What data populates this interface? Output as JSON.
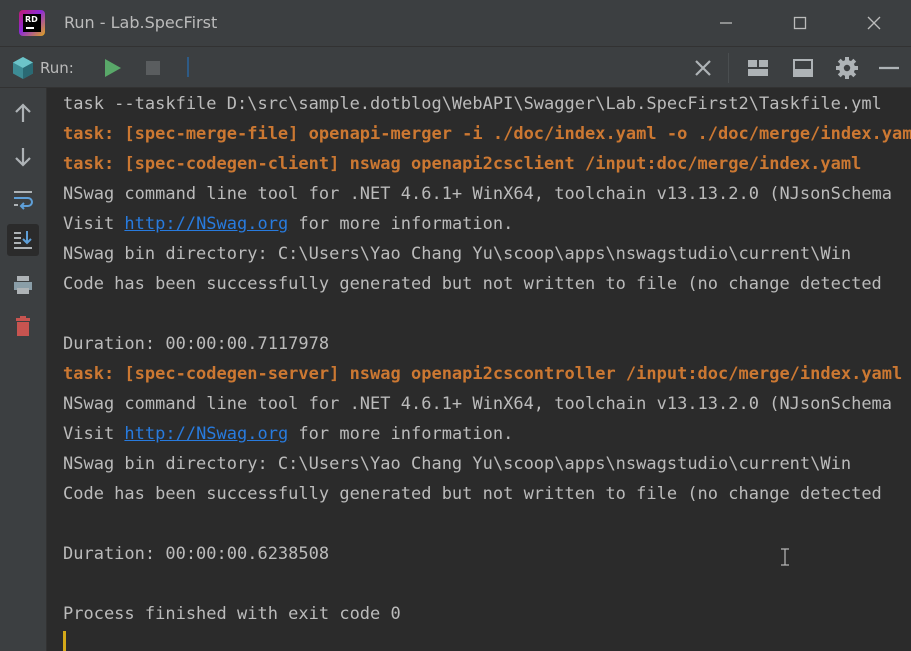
{
  "window": {
    "title": "Run - Lab.SpecFirst",
    "logo_text": "RD",
    "controls": [
      "minimize-icon",
      "maximize-icon",
      "close-icon"
    ]
  },
  "run_toolbar": {
    "label": "Run:",
    "buttons": [
      "rerun-icon",
      "stop-icon",
      "close-tab-icon",
      "layout-icon",
      "restore-layout-icon",
      "settings-icon",
      "hide-icon"
    ]
  },
  "side_toolbar": {
    "buttons": [
      "up-arrow-icon",
      "down-arrow-icon",
      "soft-wrap-icon",
      "scroll-to-end-icon",
      "print-icon",
      "trash-icon"
    ],
    "active": "scroll-to-end-icon"
  },
  "console": {
    "lines": [
      {
        "text": "task --taskfile D:\\src\\sample.dotblog\\WebAPI\\Swagger\\Lab.SpecFirst2\\Taskfile.yml"
      },
      {
        "text": "task: [spec-merge-file] openapi-merger -i ./doc/index.yaml -o ./doc/merge/index.yaml"
      },
      {
        "text": "task: [spec-codegen-client] nswag openapi2csclient /input:doc/merge/index.yaml"
      },
      {
        "text": "NSwag command line tool for .NET 4.6.1+ WinX64, toolchain v13.13.2.0 (NJsonSchema"
      },
      {
        "prefix": "Visit ",
        "link": "http://NSwag.org",
        "suffix": " for more information."
      },
      {
        "text": "NSwag bin directory: C:\\Users\\Yao Chang Yu\\scoop\\apps\\nswagstudio\\current\\Win"
      },
      {
        "text": "Code has been successfully generated but not written to file (no change detected"
      },
      {
        "text": ""
      },
      {
        "text": "Duration: 00:00:00.7117978"
      },
      {
        "text": "task: [spec-codegen-server] nswag openapi2cscontroller /input:doc/merge/index.yaml"
      },
      {
        "text": "NSwag command line tool for .NET 4.6.1+ WinX64, toolchain v13.13.2.0 (NJsonSchema"
      },
      {
        "prefix": "Visit ",
        "link": "http://NSwag.org",
        "suffix": " for more information."
      },
      {
        "text": "NSwag bin directory: C:\\Users\\Yao Chang Yu\\scoop\\apps\\nswagstudio\\current\\Win"
      },
      {
        "text": "Code has been successfully generated but not written to file (no change detected"
      },
      {
        "text": ""
      },
      {
        "text": "Duration: 00:00:00.6238508"
      },
      {
        "text": ""
      },
      {
        "text": "Process finished with exit code 0"
      }
    ]
  },
  "colors": {
    "background": "#2b2b2b",
    "chrome": "#3c3f41",
    "text": "#bbbbbb",
    "task": "#cc7832",
    "link": "#287bde",
    "caret": "#d4a919",
    "run_green": "#59a869",
    "stop_gray": "#5a5d5f",
    "trash_red": "#c75450"
  }
}
